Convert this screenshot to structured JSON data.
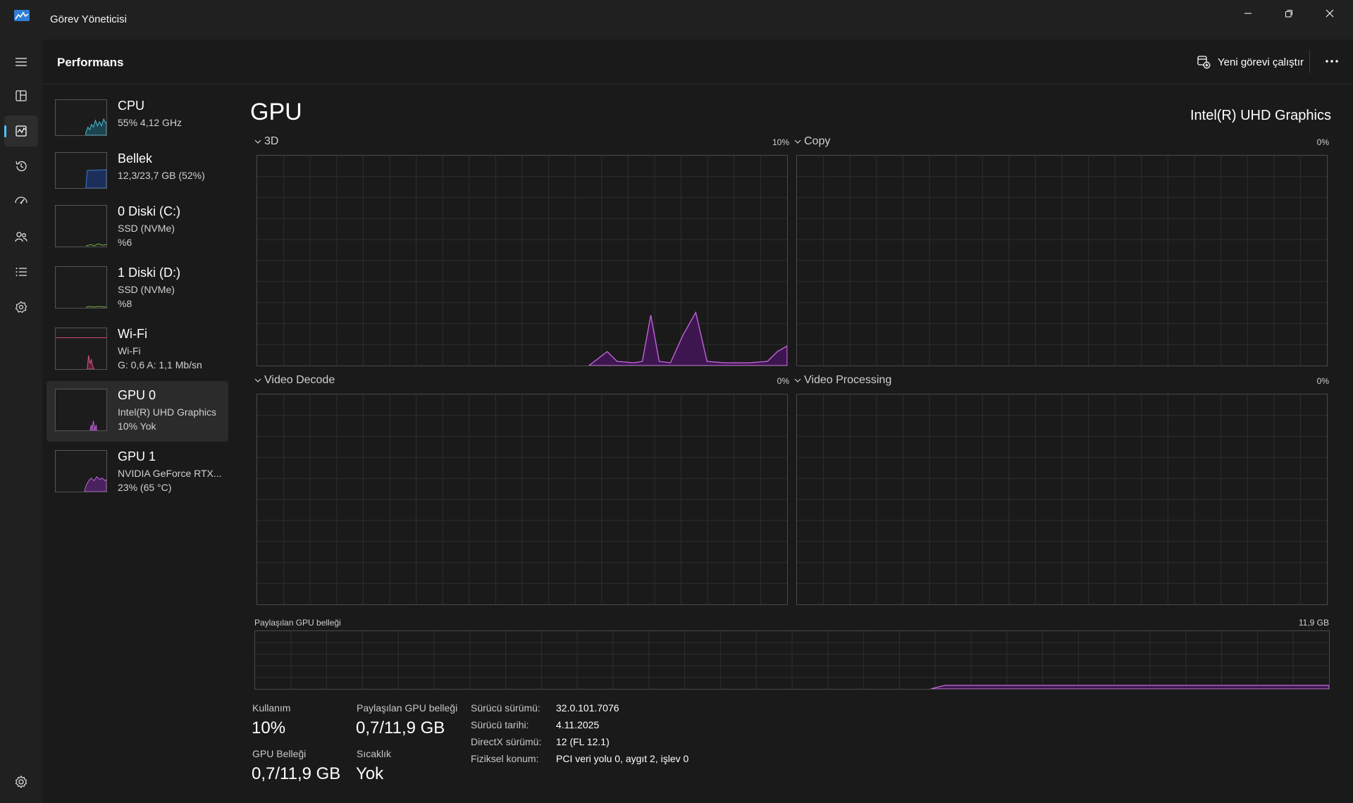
{
  "window": {
    "title": "Görev Yöneticisi",
    "accent": "#4cc2ff",
    "gpu_color": "#c264d8"
  },
  "nav": {
    "items": [
      {
        "icon": "hamburger-menu-icon"
      },
      {
        "icon": "processes-icon"
      },
      {
        "icon": "performance-icon",
        "active": true
      },
      {
        "icon": "app-history-icon"
      },
      {
        "icon": "startup-apps-icon"
      },
      {
        "icon": "users-icon"
      },
      {
        "icon": "details-icon"
      },
      {
        "icon": "services-icon"
      }
    ],
    "settings_icon": "settings-gear-icon"
  },
  "header": {
    "title": "Performans",
    "run_task_label": "Yeni görevi çalıştır"
  },
  "devices": [
    {
      "name": "CPU",
      "line1": "55%  4,12 GHz",
      "line2": ""
    },
    {
      "name": "Bellek",
      "line1": "12,3/23,7 GB (52%)",
      "line2": ""
    },
    {
      "name": "0 Diski (C:)",
      "line1": "SSD (NVMe)",
      "line2": "%6"
    },
    {
      "name": "1 Diski (D:)",
      "line1": "SSD (NVMe)",
      "line2": "%8"
    },
    {
      "name": "Wi-Fi",
      "line1": "Wi-Fi",
      "line2": "G: 0,6  A: 1,1 Mb/sn"
    },
    {
      "name": "GPU 0",
      "line1": "Intel(R) UHD Graphics",
      "line2": "10%  Yok",
      "active": true
    },
    {
      "name": "GPU 1",
      "line1": "NVIDIA GeForce RTX...",
      "line2": "23%  (65 °C)"
    }
  ],
  "gpu": {
    "title": "GPU",
    "model": "Intel(R) UHD Graphics",
    "engines": [
      {
        "label": "3D",
        "percent": "10%"
      },
      {
        "label": "Copy",
        "percent": "0%"
      },
      {
        "label": "Video Decode",
        "percent": "0%"
      },
      {
        "label": "Video Processing",
        "percent": "0%"
      }
    ],
    "shared_memory": {
      "label": "Paylaşılan GPU belleği",
      "max": "11,9 GB"
    }
  },
  "stats": {
    "usage_label": "Kullanım",
    "usage_value": "10%",
    "shared_label": "Paylaşılan GPU belleği",
    "shared_value": "0,7/11,9 GB",
    "gpu_memory_label": "GPU Belleği",
    "gpu_memory_value": "0,7/11,9 GB",
    "temp_label": "Sıcaklık",
    "temp_value": "Yok"
  },
  "info": [
    {
      "key": "Sürücü sürümü:",
      "value": "32.0.101.7076"
    },
    {
      "key": "Sürücü tarihi:",
      "value": "4.11.2025"
    },
    {
      "key": "DirectX sürümü:",
      "value": "12 (FL 12.1)"
    },
    {
      "key": "Fiziksel konum:",
      "value": "PCI veri yolu 0, aygıt 2, işlev 0"
    }
  ]
}
